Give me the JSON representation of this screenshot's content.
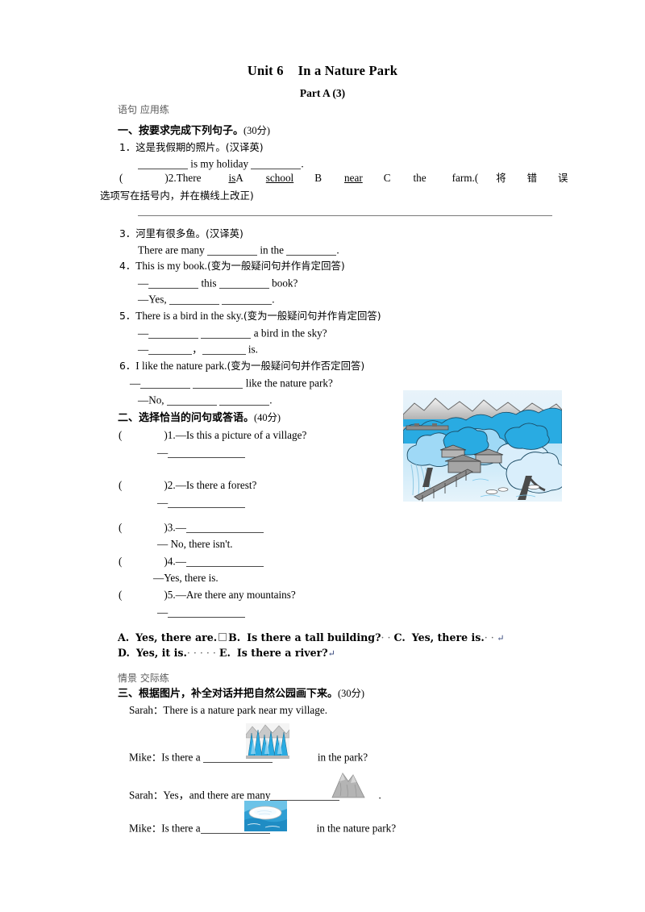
{
  "header": {
    "unit": "Unit 6",
    "title": "In a Nature Park",
    "part": "Part A (3)"
  },
  "categories": {
    "sentence_practice": "语句 应用练",
    "situational_practice": "情景 交际练"
  },
  "section1": {
    "heading_cn": "一、按要求完成下列句子。",
    "heading_score": "(30分)",
    "items": [
      {
        "num": "1．",
        "prompt_cn": "这是我假期的照片。",
        "prompt_tag": "(汉译英)",
        "answer_pre": "is my holiday",
        "answer_post": "."
      },
      {
        "num": ")2.",
        "text_1": "There",
        "text_2": "is",
        "mark_a": "A",
        "text_3": "school",
        "mark_b": "B",
        "text_4": "near",
        "mark_c": "C",
        "text_5": "the",
        "text_6": "farm.(",
        "cn_1": "将",
        "cn_2": "错",
        "cn_3": "误",
        "cn_tail": "选项写在括号内，并在横线上改正)"
      },
      {
        "num": "3．",
        "prompt_cn": "河里有很多鱼。",
        "prompt_tag": "(汉译英)",
        "answer_pre": "There are many",
        "answer_mid": "in the",
        "answer_post": "."
      },
      {
        "num": "4．",
        "prompt_en": "This is my book.",
        "prompt_tag": "(变为一般疑问句并作肯定回答)",
        "line1_pre": "—",
        "line1_mid": "this",
        "line1_post": "book?",
        "line2_pre": "—Yes,",
        "line2_post": "."
      },
      {
        "num": "5．",
        "prompt_en": "There is a bird in the sky.",
        "prompt_tag": "(变为一般疑问句并作肯定回答)",
        "line1_pre": "—",
        "line1_post": "a bird in the sky?",
        "line2_pre": "—",
        "line2_comma": "，",
        "line2_post": "is."
      },
      {
        "num": "6．",
        "prompt_en": "I like the nature park.",
        "prompt_tag": "(变为一般疑问句并作否定回答)",
        "line1_pre": "—",
        "line1_post": "like the nature park?",
        "line2_pre": "—No,",
        "line2_post": "."
      }
    ]
  },
  "section2": {
    "heading_cn": "二、选择恰当的问句或答语。",
    "heading_score": "(40分)",
    "items": [
      {
        "num": ")1.",
        "q": "—Is this a picture of a village?",
        "a": "—"
      },
      {
        "num": ")2.",
        "q": "—Is there a forest?",
        "a": "—"
      },
      {
        "num": ")3.",
        "q": "—",
        "a": "— No, there isn't."
      },
      {
        "num": ")4.",
        "q": "—",
        "a": "—Yes, there is."
      },
      {
        "num": ")5.",
        "q": "—Are there any mountains?",
        "a": "—"
      }
    ],
    "options_line1": [
      {
        "label": "A.",
        "text": "Yes, there are."
      },
      {
        "label": "B.",
        "text": "Is there a tall building?"
      },
      {
        "label": "C.",
        "text": "Yes, there is."
      }
    ],
    "options_line2": [
      {
        "label": "D.",
        "text": "Yes, it is."
      },
      {
        "label": "E.",
        "text": "Is there a river?"
      }
    ]
  },
  "section3": {
    "heading_cn": "三、根据图片，补全对话并把自然公园画下来。",
    "heading_score": "(30分)",
    "lines": [
      {
        "speaker": "Sarah",
        "colon": "：",
        "text": "There is a nature park near my village."
      },
      {
        "speaker": "Mike",
        "colon": "：",
        "pre": "Is there a",
        "post": "in the park?",
        "image": "forest-image"
      },
      {
        "speaker": "Sarah",
        "colon": "：",
        "pre": "Yes，and there are many",
        "post": ".",
        "image": "mountain-image"
      },
      {
        "speaker": "Mike",
        "colon": "：",
        "pre": "Is there a",
        "post": "in the nature park?",
        "image": "lake-image"
      }
    ]
  },
  "images": {
    "main": "nature-park-illustration",
    "forest": "forest-thumbnail",
    "mountain": "mountain-thumbnail",
    "lake": "lake-thumbnail"
  },
  "colors": {
    "sky_blue": "#29abe2",
    "light_blue": "#9fd9f6",
    "pale_blue": "#d9eefb",
    "grey": "#9b9b9b",
    "dark_grey": "#5a5a5a",
    "rule": "#7a7a7a"
  }
}
